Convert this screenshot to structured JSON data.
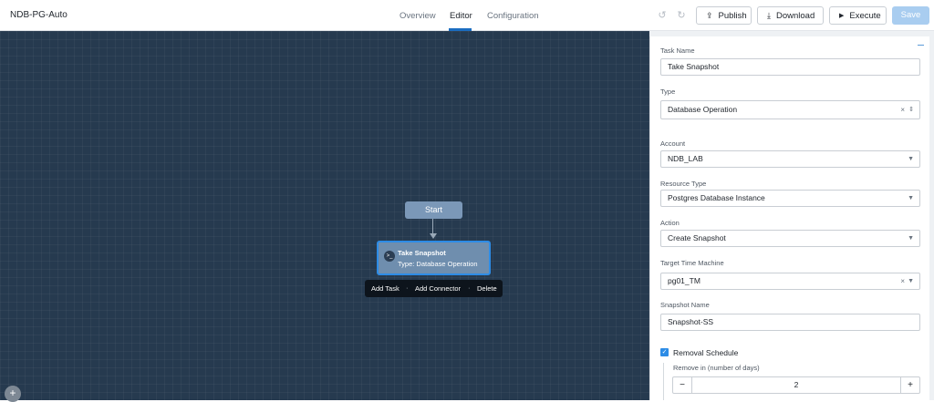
{
  "app": {
    "title": "NDB-PG-Auto"
  },
  "tabs": [
    {
      "label": "Overview",
      "active": false
    },
    {
      "label": "Editor",
      "active": true
    },
    {
      "label": "Configuration",
      "active": false
    }
  ],
  "toolbar": {
    "undo_icon": "undo-icon",
    "redo_icon": "redo-icon",
    "publish_label": "Publish",
    "download_label": "Download",
    "execute_label": "Execute",
    "save_label": "Save",
    "accent": "#1b6dc1"
  },
  "canvas": {
    "start_label": "Start",
    "task": {
      "name": "Take Snapshot",
      "type": "Type: Database Operation"
    },
    "menu": {
      "add_task": "Add Task",
      "add_connector": "Add Connector",
      "delete": "Delete"
    }
  },
  "panel": {
    "task_name_label": "Task Name",
    "task_name_value": "Take Snapshot",
    "type_label": "Type",
    "type_value": "Database Operation",
    "account_label": "Account",
    "account_value": "NDB_LAB",
    "resource_type_label": "Resource Type",
    "resource_type_value": "Postgres Database Instance",
    "action_label": "Action",
    "action_value": "Create Snapshot",
    "target_tm_label": "Target Time Machine",
    "target_tm_value": "pg01_TM",
    "snapshot_name_label": "Snapshot Name",
    "snapshot_name_value": "Snapshot-SS",
    "removal_schedule_label": "Removal Schedule",
    "removal_schedule_checked": true,
    "remove_in_label": "Remove in (number of days)",
    "remove_in_value": "2"
  }
}
